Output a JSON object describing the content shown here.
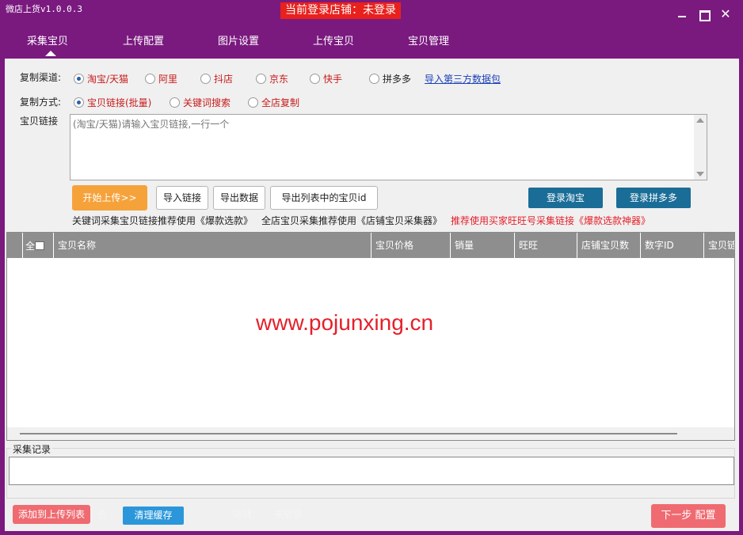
{
  "window": {
    "title": "微店上货v1.0.0.3",
    "login_status": "当前登录店铺：未登录",
    "controls": {
      "minimize": "",
      "maximize": "",
      "close": "✕"
    }
  },
  "tabs": [
    {
      "label": "采集宝贝",
      "active": true
    },
    {
      "label": "上传配置"
    },
    {
      "label": "图片设置"
    },
    {
      "label": "上传宝贝"
    },
    {
      "label": "宝贝管理"
    }
  ],
  "channel": {
    "label": "复制渠道:",
    "options": [
      "淘宝/天猫",
      "阿里",
      "抖店",
      "京东",
      "快手",
      "拼多多"
    ],
    "selected": "淘宝/天猫",
    "import_link": "导入第三方数据包"
  },
  "method": {
    "label": "复制方式:",
    "options": [
      "宝贝链接(批量)",
      "关键词搜索",
      "全店复制"
    ],
    "selected": "宝贝链接(批量)"
  },
  "links": {
    "label": "宝贝链接",
    "placeholder": "(淘宝/天猫)请输入宝贝链接,一行一个"
  },
  "actions": {
    "start": "开始上传>>",
    "import": "导入链接",
    "export": "导出数据",
    "export_ids": "导出列表中的宝贝id",
    "login_taobao": "登录淘宝",
    "login_pdd": "登录拼多多"
  },
  "hints": {
    "keyword": "关键词采集宝贝链接推荐使用《爆款选款》",
    "shop": "全店宝贝采集推荐使用《店铺宝贝采集器》",
    "recommend": "推荐使用买家旺旺号采集链接《爆款选款神器》"
  },
  "table": {
    "columns": [
      "全选",
      "宝贝名称",
      "宝贝价格",
      "销量",
      "旺旺",
      "店铺宝贝数",
      "数字ID",
      "宝贝链"
    ],
    "rows": [],
    "watermark": "www.pojunxing.cn"
  },
  "log": {
    "title": "采集记录",
    "value": ""
  },
  "footer": {
    "add_to_list": "添加到上传列表",
    "clear_cache": "清理缓存",
    "next": "下一步 配置",
    "faded_1": "合",
    "faded_2": "店铺：",
    "faded_3": "未登录"
  }
}
